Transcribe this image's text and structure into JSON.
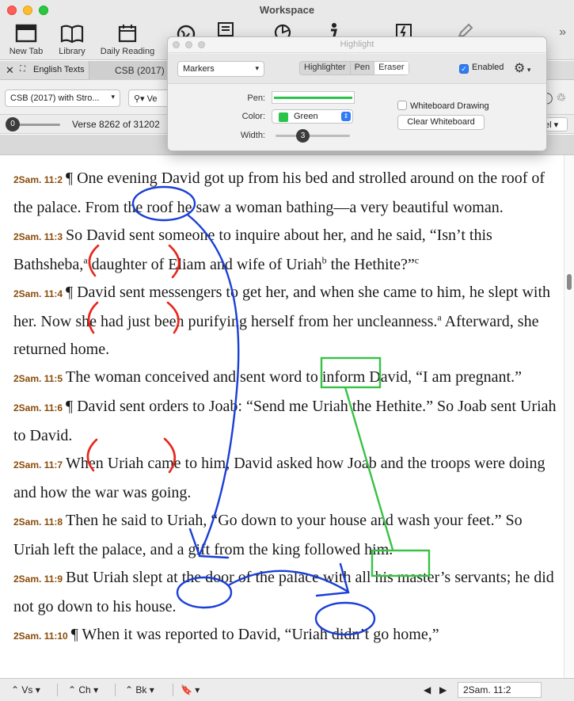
{
  "window": {
    "title": "Workspace"
  },
  "toolbar": {
    "items": [
      {
        "label": "New Tab",
        "icon": "new-tab-icon"
      },
      {
        "label": "Library",
        "icon": "library-icon"
      },
      {
        "label": "Daily Reading",
        "icon": "calendar-icon"
      }
    ],
    "overflow": "»"
  },
  "tabs": {
    "close": "✕",
    "left_tab": "English Texts",
    "active_tab": "CSB (2017) w"
  },
  "resource": {
    "version_select": "CSB (2017) with Stro...",
    "search_prefix": "Ve",
    "right_icons": "◯ ♲"
  },
  "verse_nav": {
    "slider_value": "0",
    "text": "Verse 8262 of 31202",
    "right_select": "el"
  },
  "verses": [
    {
      "ref": "2Sam. 11:2",
      "text": "¶ One evening David got up from his bed and strolled around on the roof of the palace. From the roof he saw a woman bathing—a very beautiful woman."
    },
    {
      "ref": "2Sam. 11:3",
      "text": "So David sent someone to inquire about her, and he said, “Isn’t this Bathsheba,",
      "sup1": "a",
      "text2": " daughter of Eliam and wife of Uriah",
      "sup2": "b",
      "text3": " the Hethite?”",
      "sup3": "c"
    },
    {
      "ref": "2Sam. 11:4",
      "text": "¶ David sent messengers to get her, and when she came to him, he slept with her. Now she had just been purifying herself from her uncleanness.",
      "sup1": "a",
      "text2": " Afterward, she returned home."
    },
    {
      "ref": "2Sam. 11:5",
      "text": "The woman conceived and sent word to inform David, “I am pregnant.”"
    },
    {
      "ref": "2Sam. 11:6",
      "text": "¶ David sent orders to Joab: “Send me Uriah the Hethite.” So Joab sent Uriah to David."
    },
    {
      "ref": "2Sam. 11:7",
      "text": "When Uriah came to him, David asked how Joab and the troops were doing and how the war was going."
    },
    {
      "ref": "2Sam. 11:8",
      "text": "Then he said to Uriah, “Go down to your house and wash your feet.” So Uriah left the palace, and a gift from the king followed him."
    },
    {
      "ref": "2Sam. 11:9",
      "text": "But Uriah slept at the door of the palace with all his master’s servants; he did not go down to his house."
    },
    {
      "ref": "2Sam. 11:10",
      "text": "¶ When it was reported to David, “Uriah didn’t go home,”"
    }
  ],
  "bottom": {
    "vs": "Vs",
    "ch": "Ch",
    "bk": "Bk",
    "reference": "2Sam. 11:2"
  },
  "highlight_palette": {
    "title": "Highlight",
    "marker_select": "Markers",
    "modes": [
      "Highlighter",
      "Pen",
      "Eraser"
    ],
    "enabled_label": "Enabled",
    "enabled": true,
    "pen_label": "Pen:",
    "color_label": "Color:",
    "color_value": "Green",
    "color_hex": "#2bc44a",
    "width_label": "Width:",
    "width_value": "3",
    "whiteboard_label": "Whiteboard Drawing",
    "whiteboard_enabled": false,
    "clear_button": "Clear Whiteboard"
  },
  "ink_colors": {
    "blue": "#1a3fd6",
    "red": "#e8261c",
    "green": "#38c244"
  }
}
